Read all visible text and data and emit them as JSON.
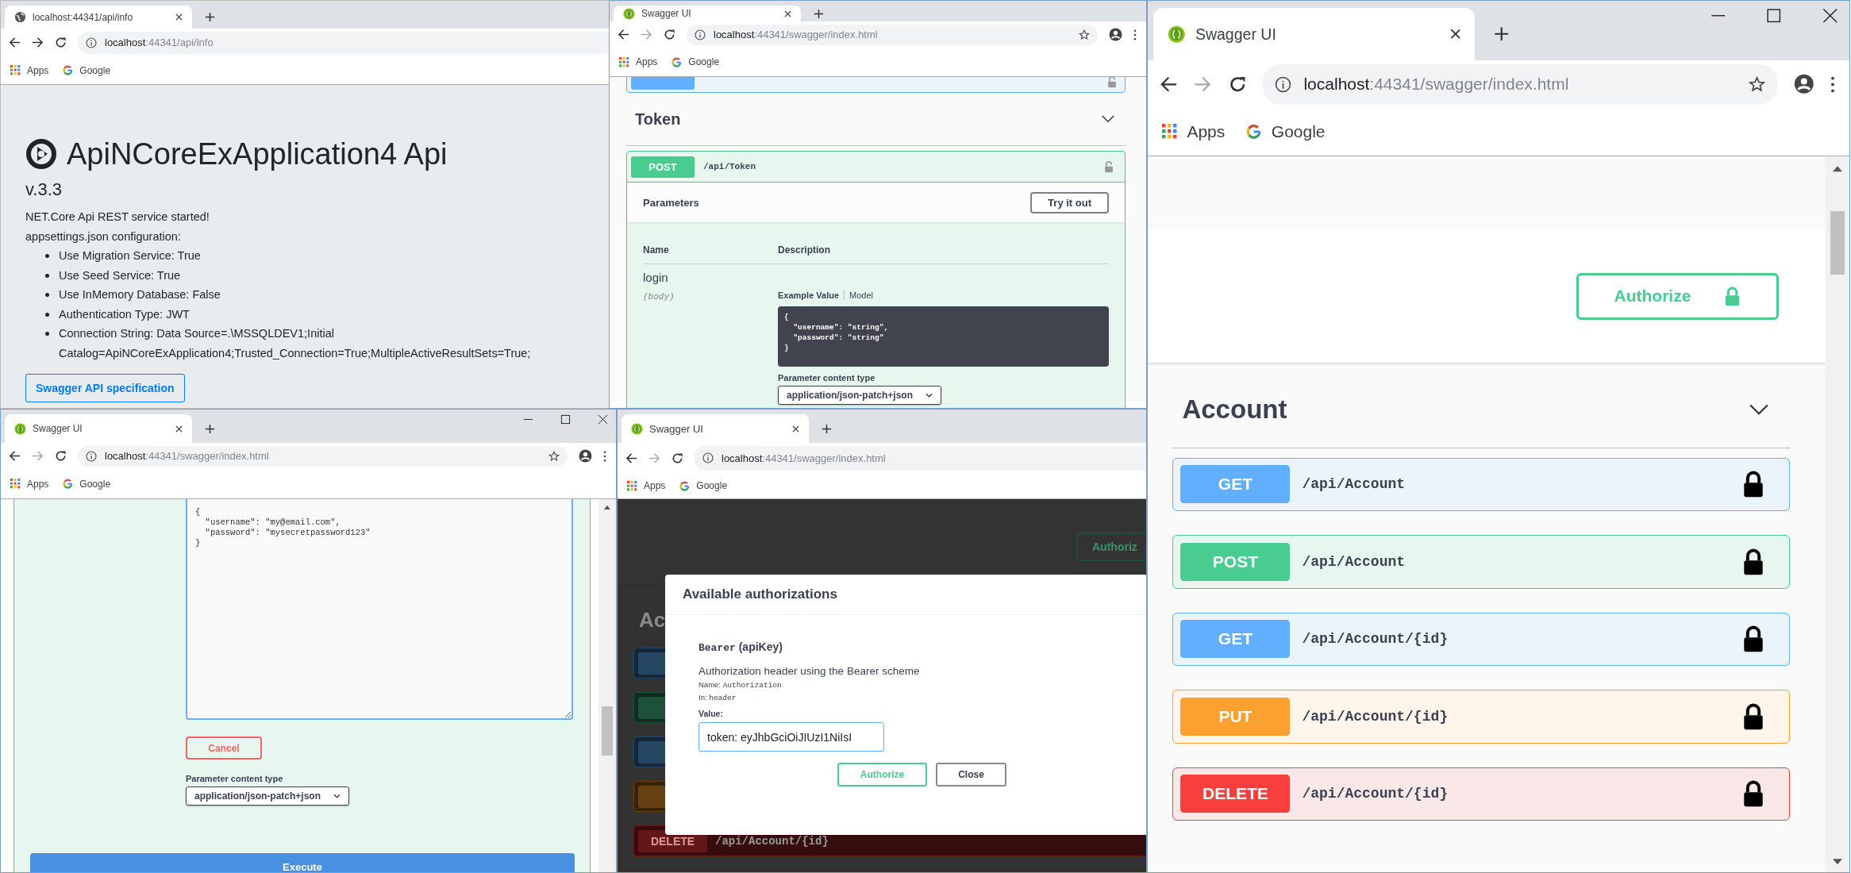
{
  "windows": [
    {
      "kind": "info",
      "tab": {
        "title": "localhost:44341/api/info"
      },
      "address": {
        "host": "localhost",
        "path": ":44341/api/info"
      },
      "forward_enabled": true,
      "toolbar_icons": false,
      "window_controls": false,
      "bookmarks": [
        {
          "label": "Apps"
        },
        {
          "label": "Google"
        }
      ],
      "page": {
        "title": "ApiNCoreExApplication4 Api",
        "version": "v.3.3",
        "lines": [
          "NET.Core Api REST service started!",
          "appsettings.json configuration:"
        ],
        "settings": [
          "Use Migration Service: True",
          "Use Seed Service: True",
          "Use InMemory Database: False",
          "Authentication Type: JWT",
          "Connection String: Data Source=.\\MSSQLDEV1;Initial Catalog=ApiNCoreExApplication4;Trusted_Connection=True;MultipleActiveResultSets=True;"
        ],
        "button": "Swagger API specification"
      }
    },
    {
      "kind": "token",
      "tab": {
        "title": "Swagger UI"
      },
      "address": {
        "host": "localhost",
        "path": ":44341/swagger/index.html"
      },
      "forward_enabled": false,
      "toolbar_icons": true,
      "window_controls": false,
      "bookmarks": [
        {
          "label": "Apps"
        },
        {
          "label": "Google"
        }
      ],
      "page": {
        "cut_operation": {
          "kind": "get",
          "authorized": false
        },
        "heading": "Token",
        "operation": {
          "kind": "post",
          "method": "POST",
          "path": "/api/Token",
          "authorized": false
        },
        "parameters_title": "Parameters",
        "try_button": "Try it out",
        "columns": [
          "Name",
          "Description"
        ],
        "param": {
          "name": "login",
          "location": "(body)"
        },
        "example_tabs": [
          {
            "label": "Example Value",
            "selected": true
          },
          {
            "label": "Model",
            "selected": false
          }
        ],
        "example_code": "{\n  \"username\": \"string\",\n  \"password\": \"string\"\n}",
        "content_type_label": "Parameter content type",
        "content_type": "application/json-patch+json"
      }
    },
    {
      "kind": "body",
      "tab": {
        "title": "Swagger UI"
      },
      "address": {
        "host": "localhost",
        "path": ":44341/swagger/index.html"
      },
      "forward_enabled": false,
      "toolbar_icons": true,
      "window_controls": true,
      "bookmarks": [
        {
          "label": "Apps"
        },
        {
          "label": "Google"
        }
      ],
      "page": {
        "request_body": "{\n  \"username\": \"my@email.com\",\n  \"password\": \"mysecretpassword123\"\n}",
        "cancel_button": "Cancel",
        "content_type_label": "Parameter content type",
        "content_type": "application/json-patch+json",
        "execute_button": "Execute"
      }
    },
    {
      "kind": "auth",
      "tab": {
        "title": "Swagger UI"
      },
      "address": {
        "host": "localhost",
        "path": ":44341/swagger/index.html"
      },
      "forward_enabled": false,
      "toolbar_icons": false,
      "window_controls": false,
      "bookmarks": [
        {
          "label": "Apps"
        },
        {
          "label": "Google"
        }
      ],
      "page": {
        "background": {
          "authorize_button": "Authoriz",
          "heading": "Ac",
          "operations": [
            {
              "kind": "get"
            },
            {
              "kind": "post"
            },
            {
              "kind": "get"
            },
            {
              "kind": "put"
            },
            {
              "kind": "delete",
              "method": "DELETE",
              "path": "/api/Account/{id}"
            }
          ]
        },
        "dialog": {
          "title": "Available authorizations",
          "scheme_name": "Bearer",
          "scheme_type": "(apiKey)",
          "description": "Authorization header using the Bearer scheme",
          "name_label": "Name:",
          "name_value": "Authorization",
          "in_label": "In:",
          "in_value": "header",
          "value_label": "Value:",
          "value": "token: eyJhbGciOiJIUzI1NiIsI",
          "buttons": [
            {
              "label": "Authorize",
              "kind": "authorize"
            },
            {
              "label": "Close",
              "kind": "close"
            }
          ]
        }
      }
    },
    {
      "kind": "ops",
      "tab": {
        "title": "Swagger UI"
      },
      "address": {
        "host": "localhost",
        "path": ":44341/swagger/index.html"
      },
      "forward_enabled": false,
      "toolbar_icons": true,
      "window_controls": true,
      "bookmarks": [
        {
          "label": "Apps"
        },
        {
          "label": "Google"
        }
      ],
      "page": {
        "authorize_button": "Authorize",
        "heading": "Account",
        "operations": [
          {
            "kind": "get",
            "method": "GET",
            "path": "/api/Account",
            "authorized": true
          },
          {
            "kind": "post",
            "method": "POST",
            "path": "/api/Account",
            "authorized": true
          },
          {
            "kind": "get",
            "method": "GET",
            "path": "/api/Account/{id}",
            "authorized": true
          },
          {
            "kind": "put",
            "method": "PUT",
            "path": "/api/Account/{id}",
            "authorized": true
          },
          {
            "kind": "delete",
            "method": "DELETE",
            "path": "/api/Account/{id}",
            "authorized": true
          }
        ]
      }
    }
  ]
}
